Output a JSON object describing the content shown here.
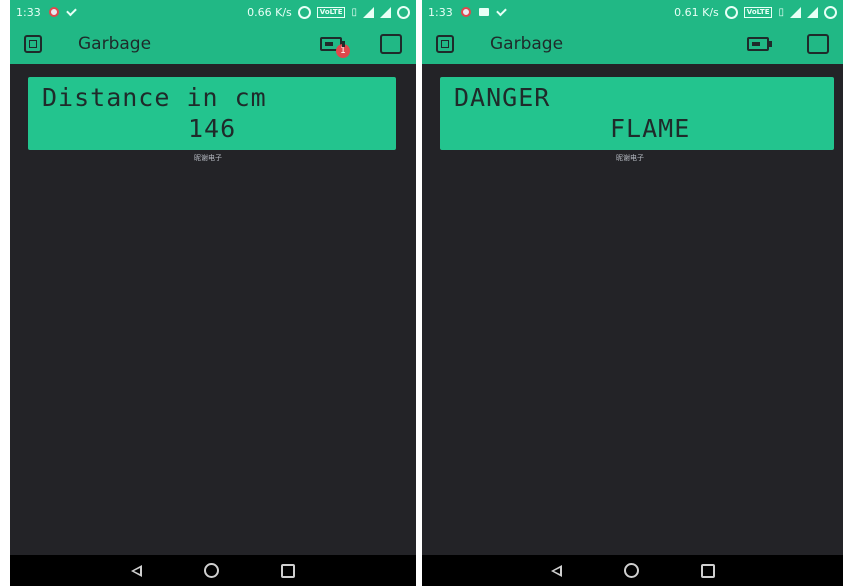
{
  "screens": [
    {
      "status": {
        "time": "1:33",
        "speed": "0.66 K/s",
        "volte": "VoLTE"
      },
      "app_title": "Garbage",
      "badge_count": "1",
      "lcd_line1": "Distance in cm",
      "lcd_line2": "146",
      "caption": "昵谢电子"
    },
    {
      "status": {
        "time": "1:33",
        "speed": "0.61 K/s",
        "volte": "VoLTE"
      },
      "app_title": "Garbage",
      "lcd_line1": "DANGER",
      "lcd_line2": "FLAME",
      "caption": "昵谢电子"
    }
  ],
  "colors": {
    "accent": "#21b885",
    "lcd": "#23c48e",
    "background": "#232327",
    "badge": "#e0474c"
  }
}
